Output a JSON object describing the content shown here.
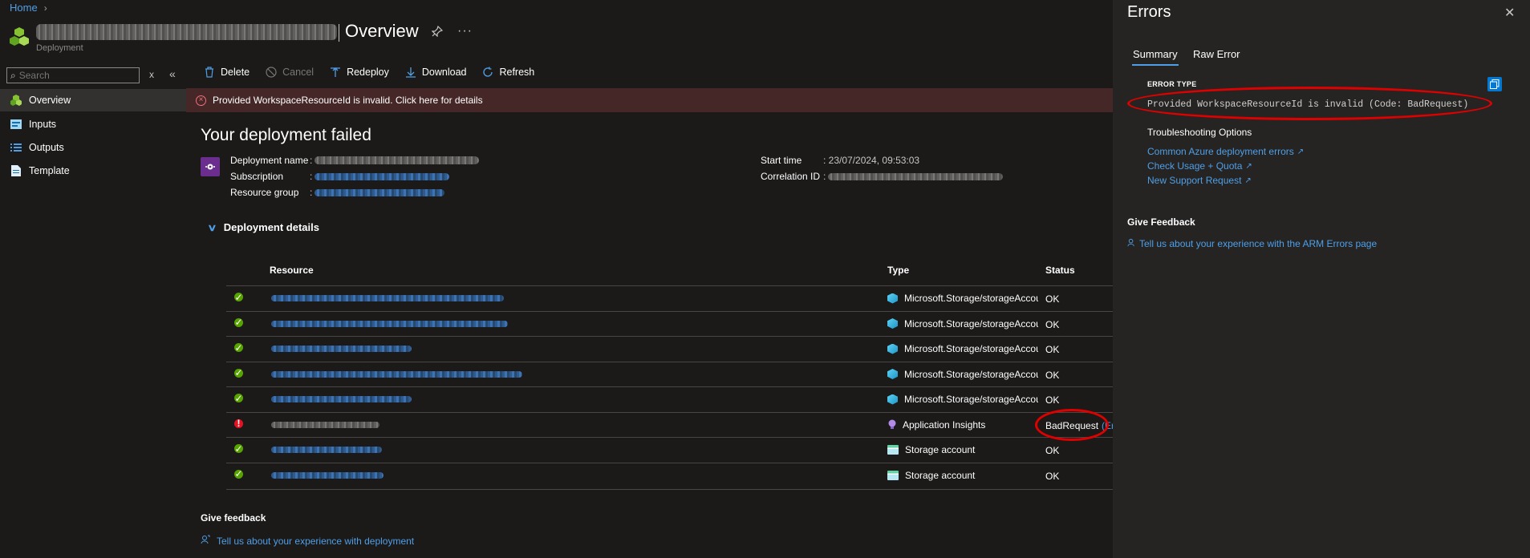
{
  "breadcrumb": {
    "home": "Home"
  },
  "header": {
    "title": "Overview",
    "subtitle": "Deployment"
  },
  "search": {
    "placeholder": "Search",
    "clear": "x"
  },
  "nav": {
    "items": [
      {
        "label": "Overview",
        "icon": "overview-icon"
      },
      {
        "label": "Inputs",
        "icon": "inputs-icon"
      },
      {
        "label": "Outputs",
        "icon": "outputs-icon"
      },
      {
        "label": "Template",
        "icon": "template-icon"
      }
    ]
  },
  "toolbar": {
    "delete": "Delete",
    "cancel": "Cancel",
    "redeploy": "Redeploy",
    "download": "Download",
    "refresh": "Refresh"
  },
  "banner": {
    "text": "Provided WorkspaceResourceId is invalid. Click here for details"
  },
  "deployment": {
    "status_title": "Your deployment failed",
    "name_label": "Deployment name",
    "subscription_label": "Subscription",
    "resource_group_label": "Resource group",
    "start_time_label": "Start time",
    "start_time_value": "23/07/2024, 09:53:03",
    "correlation_label": "Correlation ID"
  },
  "details": {
    "toggle_label": "Deployment details",
    "columns": {
      "resource": "Resource",
      "type": "Type",
      "status": "Status"
    },
    "rows": [
      {
        "state": "ok",
        "type": "Microsoft.Storage/storageAccou",
        "type_icon": "storage-cube",
        "status": "OK"
      },
      {
        "state": "ok",
        "type": "Microsoft.Storage/storageAccou",
        "type_icon": "storage-cube",
        "status": "OK"
      },
      {
        "state": "ok",
        "type": "Microsoft.Storage/storageAccou",
        "type_icon": "storage-cube",
        "status": "OK"
      },
      {
        "state": "ok",
        "type": "Microsoft.Storage/storageAccou",
        "type_icon": "storage-cube",
        "status": "OK"
      },
      {
        "state": "ok",
        "type": "Microsoft.Storage/storageAccou",
        "type_icon": "storage-cube",
        "status": "OK"
      },
      {
        "state": "error",
        "type": "Application Insights",
        "type_icon": "bulb",
        "status": "BadRequest",
        "status_link": "(Err"
      },
      {
        "state": "ok",
        "type": "Storage account",
        "type_icon": "storage-account",
        "status": "OK"
      },
      {
        "state": "ok",
        "type": "Storage account",
        "type_icon": "storage-account",
        "status": "OK"
      }
    ]
  },
  "feedback": {
    "heading": "Give feedback",
    "link": "Tell us about your experience with deployment"
  },
  "errors_panel": {
    "title": "Errors",
    "tabs": [
      "Summary",
      "Raw Error"
    ],
    "error_type_label": "ERROR TYPE",
    "error_message": "Provided WorkspaceResourceId is invalid (Code: BadRequest)",
    "troubleshooting_label": "Troubleshooting Options",
    "links": [
      "Common Azure deployment errors",
      "Check Usage + Quota",
      "New Support Request"
    ],
    "feedback_heading": "Give Feedback",
    "feedback_link": "Tell us about your experience with the ARM Errors page"
  },
  "colors": {
    "accent": "#4f9fe8",
    "error": "#e81123",
    "success": "#57a300",
    "annotation": "#e10000"
  }
}
